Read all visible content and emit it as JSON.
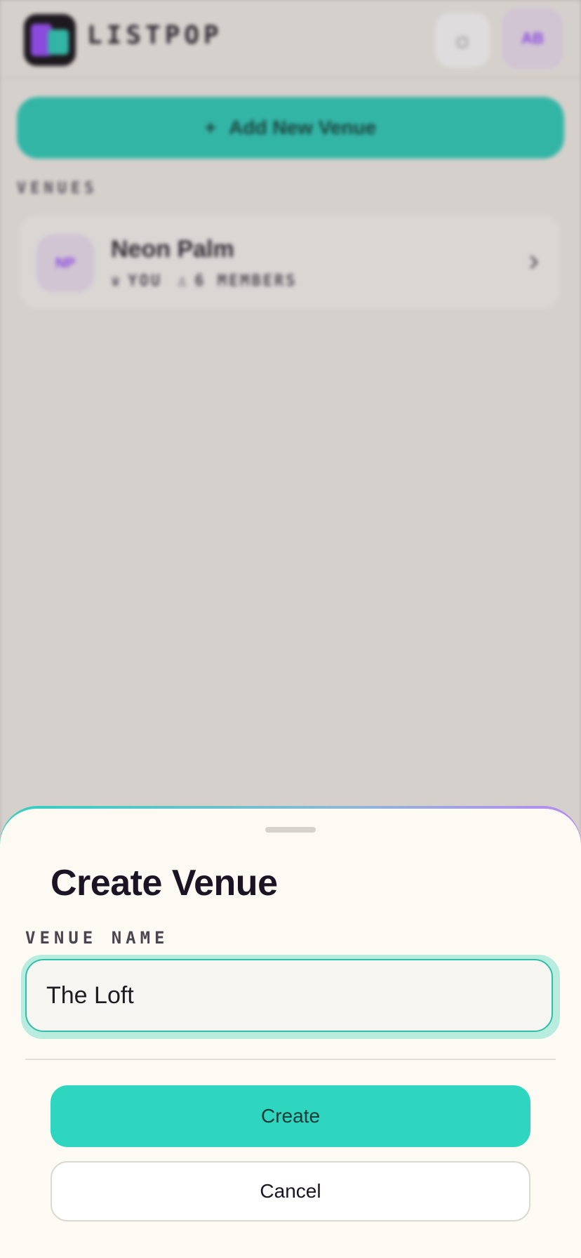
{
  "app": {
    "logo_text": "LISTPOP",
    "logo_icon": "listpop-logo-icon",
    "theme_icon": "sun-icon",
    "avatar_initials": "AB",
    "add_venue_label": "Add New Venue",
    "add_venue_icon": "plus-icon",
    "venues_heading": "VENUES",
    "venues": [
      {
        "initials": "NP",
        "name": "Neon Palm",
        "owner_icon": "crown-icon",
        "owner_label": "YOU",
        "members_icon": "user-icon",
        "members_label": "6 MEMBERS",
        "chevron_icon": "chevron-right-icon"
      }
    ]
  },
  "sheet": {
    "title": "Create Venue",
    "field_label": "VENUE NAME",
    "field_value": "The Loft",
    "create_label": "Create",
    "cancel_label": "Cancel"
  },
  "colors": {
    "accent": "#2ed6c0",
    "brand_purple": "#9b4dff",
    "sheet_bg": "#fdfaf3"
  }
}
